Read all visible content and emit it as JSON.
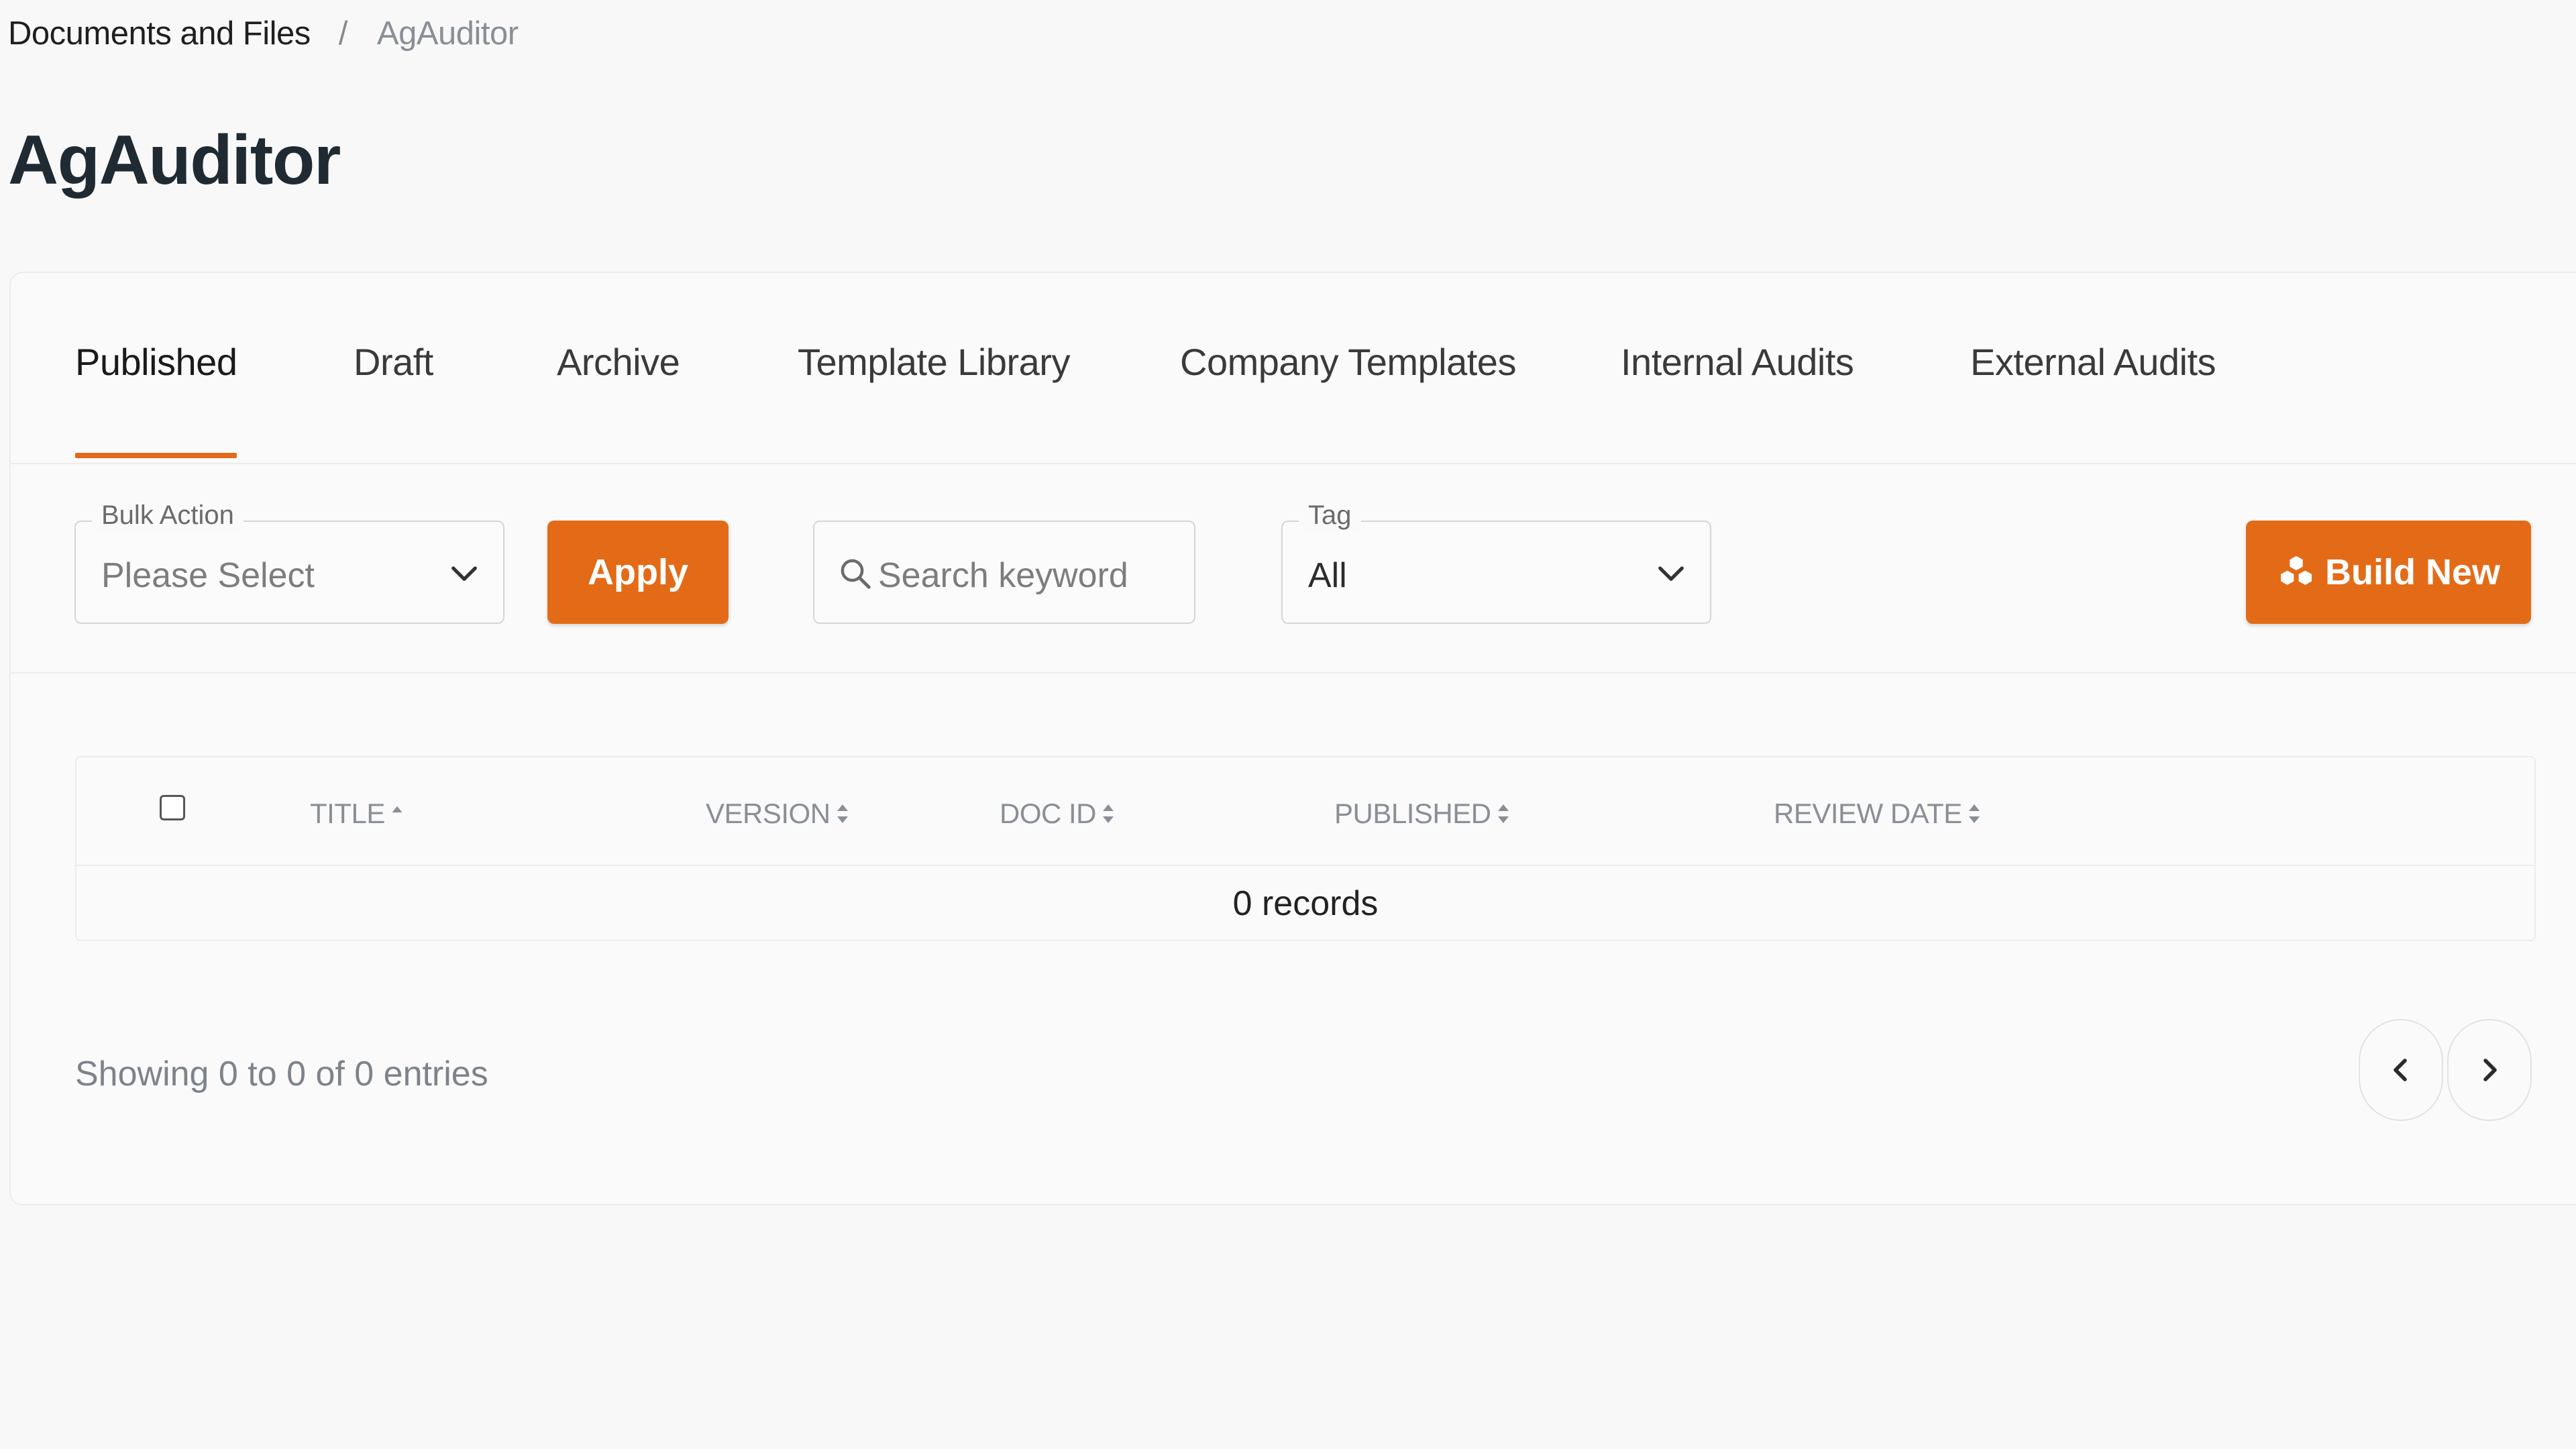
{
  "breadcrumb": {
    "parent": "Documents and Files",
    "separator": "/",
    "current": "AgAuditor"
  },
  "page_title": "AgAuditor",
  "tabs": [
    {
      "label": "Published",
      "active": true
    },
    {
      "label": "Draft",
      "active": false
    },
    {
      "label": "Archive",
      "active": false
    },
    {
      "label": "Template Library",
      "active": false
    },
    {
      "label": "Company Templates",
      "active": false
    },
    {
      "label": "Internal Audits",
      "active": false
    },
    {
      "label": "External Audits",
      "active": false
    }
  ],
  "toolbar": {
    "bulk_action": {
      "legend": "Bulk Action",
      "value": "Please Select"
    },
    "apply_label": "Apply",
    "search": {
      "placeholder": "Search keyword"
    },
    "tag": {
      "legend": "Tag",
      "value": "All"
    },
    "build_new_label": "Build New"
  },
  "table": {
    "columns": [
      {
        "label": "TITLE",
        "sort": "asc"
      },
      {
        "label": "VERSION",
        "sort": "both"
      },
      {
        "label": "DOC ID",
        "sort": "both"
      },
      {
        "label": "PUBLISHED",
        "sort": "both"
      },
      {
        "label": "REVIEW DATE",
        "sort": "both"
      }
    ],
    "empty_message": "0 records"
  },
  "footer": {
    "entries_info": "Showing 0 to 0 of 0 entries"
  },
  "colors": {
    "accent": "#e36b17",
    "background": "#f8f8f8",
    "muted_text": "#8a8f96"
  },
  "icons": {
    "dropdown": "chevron-down-icon",
    "search": "search-icon",
    "build_new": "cubes-icon",
    "sort": "sort-icon",
    "prev": "chevron-left-icon",
    "next": "chevron-right-icon"
  }
}
